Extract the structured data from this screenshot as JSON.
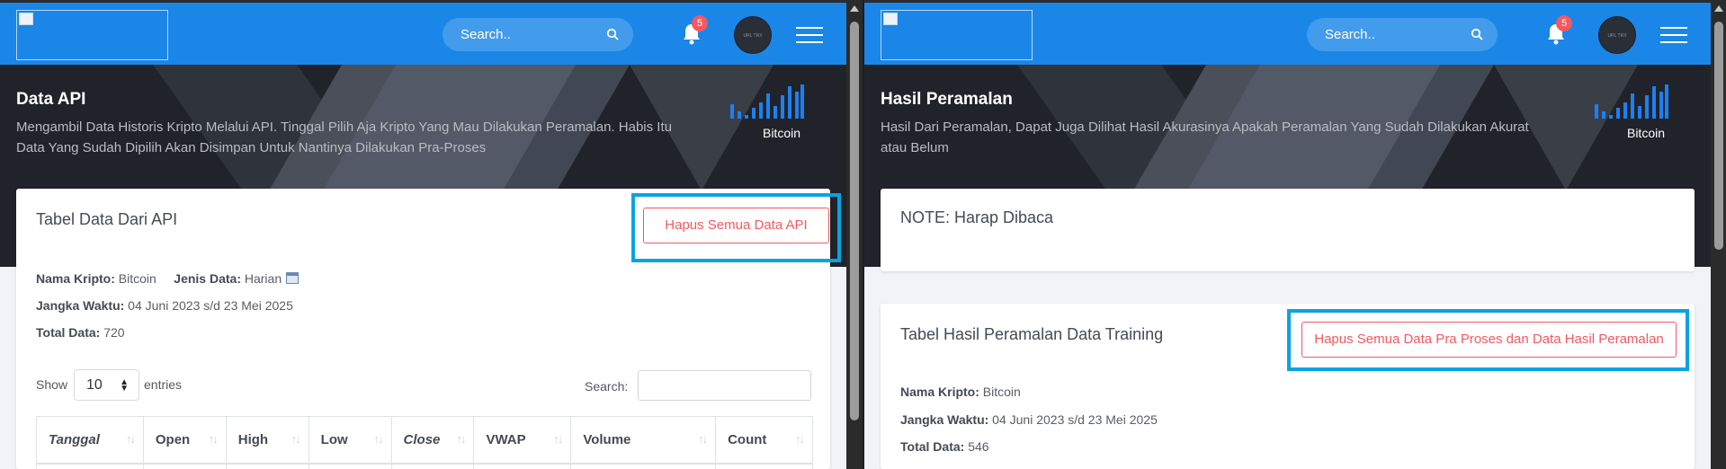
{
  "left": {
    "navbar": {
      "search_placeholder": "Search..",
      "notifications_count": "5",
      "avatar_text": "URL TRX"
    },
    "hero": {
      "title": "Data API",
      "subtitle": "Mengambil Data Historis Kripto Melalui API. Tinggal Pilih Aja Kripto Yang Mau Dilakukan Peramalan. Habis Itu Data Yang Sudah Dipilih Akan Disimpan Untuk Nantinya Dilakukan Pra-Proses",
      "coin_label": "Bitcoin"
    },
    "card": {
      "title": "Tabel Data Dari API",
      "delete_button": "Hapus Semua Data API",
      "crypto_label": "Nama Kripto:",
      "crypto_value": "Bitcoin",
      "type_label": "Jenis Data:",
      "type_value": "Harian",
      "range_label": "Jangka Waktu:",
      "range_value": "04 Juni 2023 s/d 23 Mei 2025",
      "total_label": "Total Data:",
      "total_value": "720",
      "show_label": "Show",
      "entries_value": "10",
      "entries_label": "entries",
      "search_label": "Search:",
      "columns": [
        "Tanggal",
        "Open",
        "High",
        "Low",
        "Close",
        "VWAP",
        "Volume",
        "Count"
      ]
    }
  },
  "right": {
    "navbar": {
      "search_placeholder": "Search..",
      "notifications_count": "5",
      "avatar_text": "URL TRX"
    },
    "hero": {
      "title": "Hasil Peramalan",
      "subtitle": "Hasil Dari Peramalan, Dapat Juga Dilihat Hasil Akurasinya Apakah Peramalan Yang Sudah Dilakukan Akurat atau Belum",
      "coin_label": "Bitcoin"
    },
    "note_card": {
      "title": "NOTE: Harap Dibaca"
    },
    "card": {
      "title": "Tabel Hasil Peramalan Data Training",
      "delete_button": "Hapus Semua Data Pra Proses dan Data Hasil Peramalan",
      "crypto_label": "Nama Kripto:",
      "crypto_value": "Bitcoin",
      "range_label": "Jangka Waktu:",
      "range_value": "04 Juni 2023 s/d 23 Mei 2025",
      "total_label": "Total Data:",
      "total_value": "546"
    }
  },
  "colors": {
    "navbar": "#1a86e8",
    "hero": "#202329",
    "danger": "#f25961",
    "highlight": "#08a4df"
  },
  "icons": [
    "search-icon",
    "bell-icon",
    "hamburger-menu-icon",
    "bar-chart-icon",
    "calendar-icon",
    "sort-icon",
    "broken-image-icon"
  ]
}
